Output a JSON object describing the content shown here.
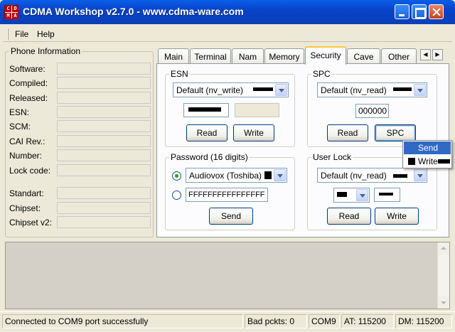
{
  "window": {
    "title": "CDMA Workshop v2.7.0  -  www.cdma-ware.com"
  },
  "menu": {
    "file": "File",
    "help": "Help"
  },
  "phone_info": {
    "title": "Phone Information",
    "labels": {
      "software": "Software:",
      "compiled": "Compiled:",
      "released": "Released:",
      "esn": "ESN:",
      "scm": "SCM:",
      "cai_rev": "CAI Rev.:",
      "number": "Number:",
      "lock_code": "Lock code:",
      "standart": "Standart:",
      "chipset": "Chipset:",
      "chipset_v2": "Chipset v2:"
    }
  },
  "tabs": {
    "main": "Main",
    "terminal": "Terminal",
    "nam": "Nam",
    "memory": "Memory",
    "security": "Security",
    "cave": "Cave",
    "other": "Other",
    "active": "Security"
  },
  "esn": {
    "title": "ESN",
    "method": "Default (nv_write)",
    "read": "Read",
    "write": "Write"
  },
  "spc": {
    "title": "SPC",
    "method": "Default (nv_read)",
    "value": "000000",
    "read": "Read",
    "spc_button": "SPC"
  },
  "password": {
    "title": "Password (16 digits)",
    "option_preset": "Audiovox (Toshiba)",
    "option_custom": "FFFFFFFFFFFFFFFF",
    "send": "Send"
  },
  "user_lock": {
    "title": "User Lock",
    "method": "Default (nv_read)",
    "read": "Read",
    "write": "Write"
  },
  "popup": {
    "send": "Send",
    "write": "Write"
  },
  "status": {
    "message": "Connected to COM9 port successfully",
    "bad_packets": "Bad pckts: 0",
    "port": "COM9",
    "at": "AT: 115200",
    "dm": "DM: 115200"
  },
  "colors": {
    "titlebar": "#0A5FE8",
    "active_tab_accent": "#FFC83C",
    "menu_highlight": "#316AC5"
  }
}
